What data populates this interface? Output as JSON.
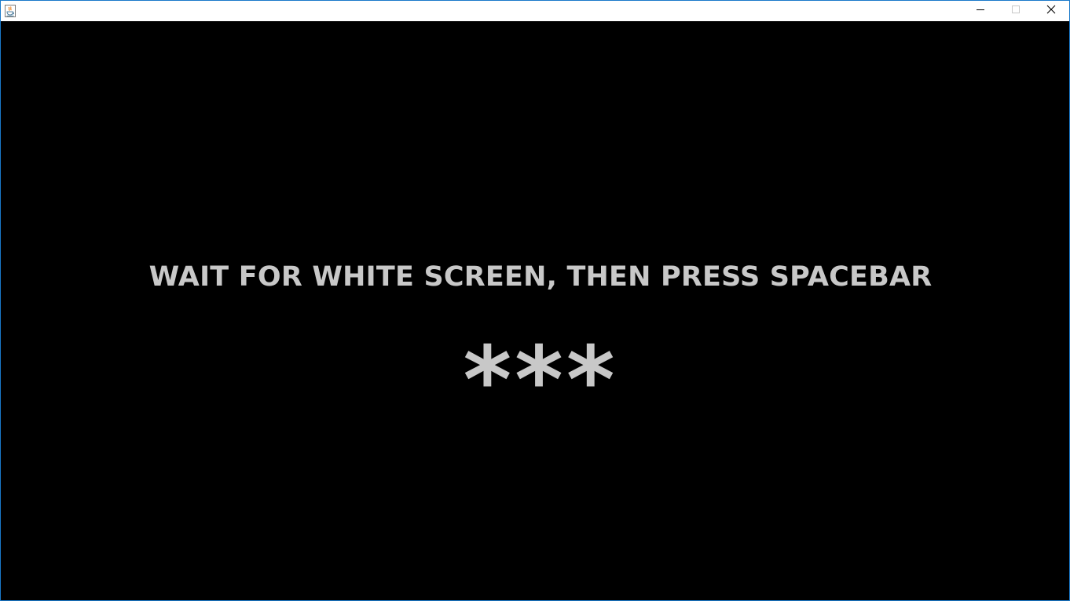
{
  "window": {
    "title": "",
    "app_icon": "java-icon",
    "controls": {
      "minimize_icon": "minimize-icon",
      "maximize_icon": "maximize-icon",
      "close_icon": "close-icon"
    }
  },
  "screen": {
    "message": "WAIT FOR WHITE SCREEN, THEN PRESS SPACEBAR",
    "stars": "***",
    "background_color": "#000000",
    "text_color": "#c8c8c8"
  }
}
